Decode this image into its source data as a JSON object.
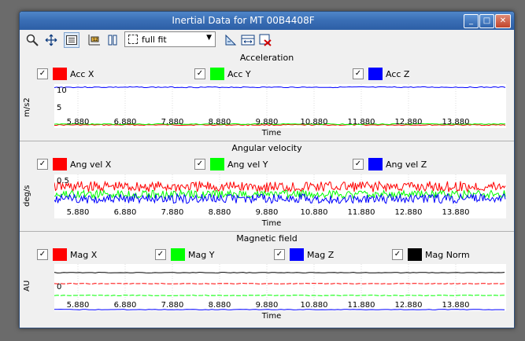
{
  "window": {
    "title": "Inertial Data for MT 00B4408F"
  },
  "titlebar_buttons": [
    "minimize",
    "maximize",
    "close"
  ],
  "toolbar": {
    "icons": [
      "zoom-icon",
      "pan-icon",
      "legend-toggle-icon",
      "axis-settings-icon",
      "pause-icon"
    ],
    "fit_selected": "full fit",
    "right_icons": [
      "scale-icon",
      "range-icon",
      "clear-icon"
    ]
  },
  "x_ticks": [
    "5.880",
    "6.880",
    "7.880",
    "8.880",
    "9.880",
    "10.880",
    "11.880",
    "12.880",
    "13.880"
  ],
  "chart_data": [
    {
      "type": "line",
      "title": "Acceleration",
      "xlabel": "Time",
      "ylabel": "m/s2",
      "yticks": [
        "10",
        "5"
      ],
      "series": [
        {
          "name": "Acc X",
          "color": "#ff0000",
          "checked": true,
          "level": 0.1
        },
        {
          "name": "Acc Y",
          "color": "#00ff00",
          "checked": true,
          "level": 0.2
        },
        {
          "name": "Acc Z",
          "color": "#0000ff",
          "checked": true,
          "level": 9.8
        }
      ]
    },
    {
      "type": "line",
      "title": "Angular velocity",
      "xlabel": "Time",
      "ylabel": "deg/s",
      "yticks": [
        "0.5"
      ],
      "series": [
        {
          "name": "Ang vel X",
          "color": "#ff0000",
          "checked": true,
          "level": 0.1
        },
        {
          "name": "Ang vel Y",
          "color": "#00ff00",
          "checked": true,
          "level": 0.0
        },
        {
          "name": "Ang vel Z",
          "color": "#0000ff",
          "checked": true,
          "level": -0.05
        }
      ]
    },
    {
      "type": "line",
      "title": "Magnetic field",
      "xlabel": "Time",
      "ylabel": "AU",
      "yticks": [
        "0"
      ],
      "series": [
        {
          "name": "Mag X",
          "color": "#ff0000",
          "checked": true,
          "level": 0.5
        },
        {
          "name": "Mag Y",
          "color": "#00ff00",
          "checked": true,
          "level": 0.0
        },
        {
          "name": "Mag Z",
          "color": "#0000ff",
          "checked": true,
          "level": -0.8
        },
        {
          "name": "Mag Norm",
          "color": "#000000",
          "checked": true,
          "level": 1.0
        }
      ]
    }
  ]
}
